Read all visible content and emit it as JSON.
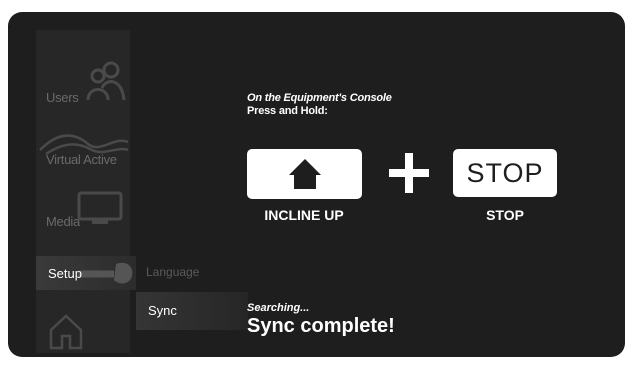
{
  "sidebar": {
    "items": [
      {
        "label": "Users",
        "icon": "users-icon"
      },
      {
        "label": "Virtual Active",
        "icon": "virtual-active-icon"
      },
      {
        "label": "Media",
        "icon": "media-icon"
      },
      {
        "label": "Setup",
        "icon": "wrench-icon"
      },
      {
        "label": "",
        "icon": "home-icon"
      }
    ],
    "selected": "Setup"
  },
  "submenu": {
    "items": [
      "Language",
      "Sync"
    ],
    "selected": "Sync"
  },
  "instructions": {
    "line1": "On the Equipment's Console",
    "line2": "Press and Hold:"
  },
  "keys": {
    "incline_label": "INCLINE UP",
    "stop_button_text": "STOP",
    "stop_label": "STOP",
    "incline_icon": "home-icon"
  },
  "status": {
    "searching": "Searching...",
    "result": "Sync complete!"
  },
  "colors": {
    "background": "#1e1e1e",
    "sidebar": "#272727",
    "text": "#ffffff",
    "dimmed": "#6a6a6a"
  }
}
